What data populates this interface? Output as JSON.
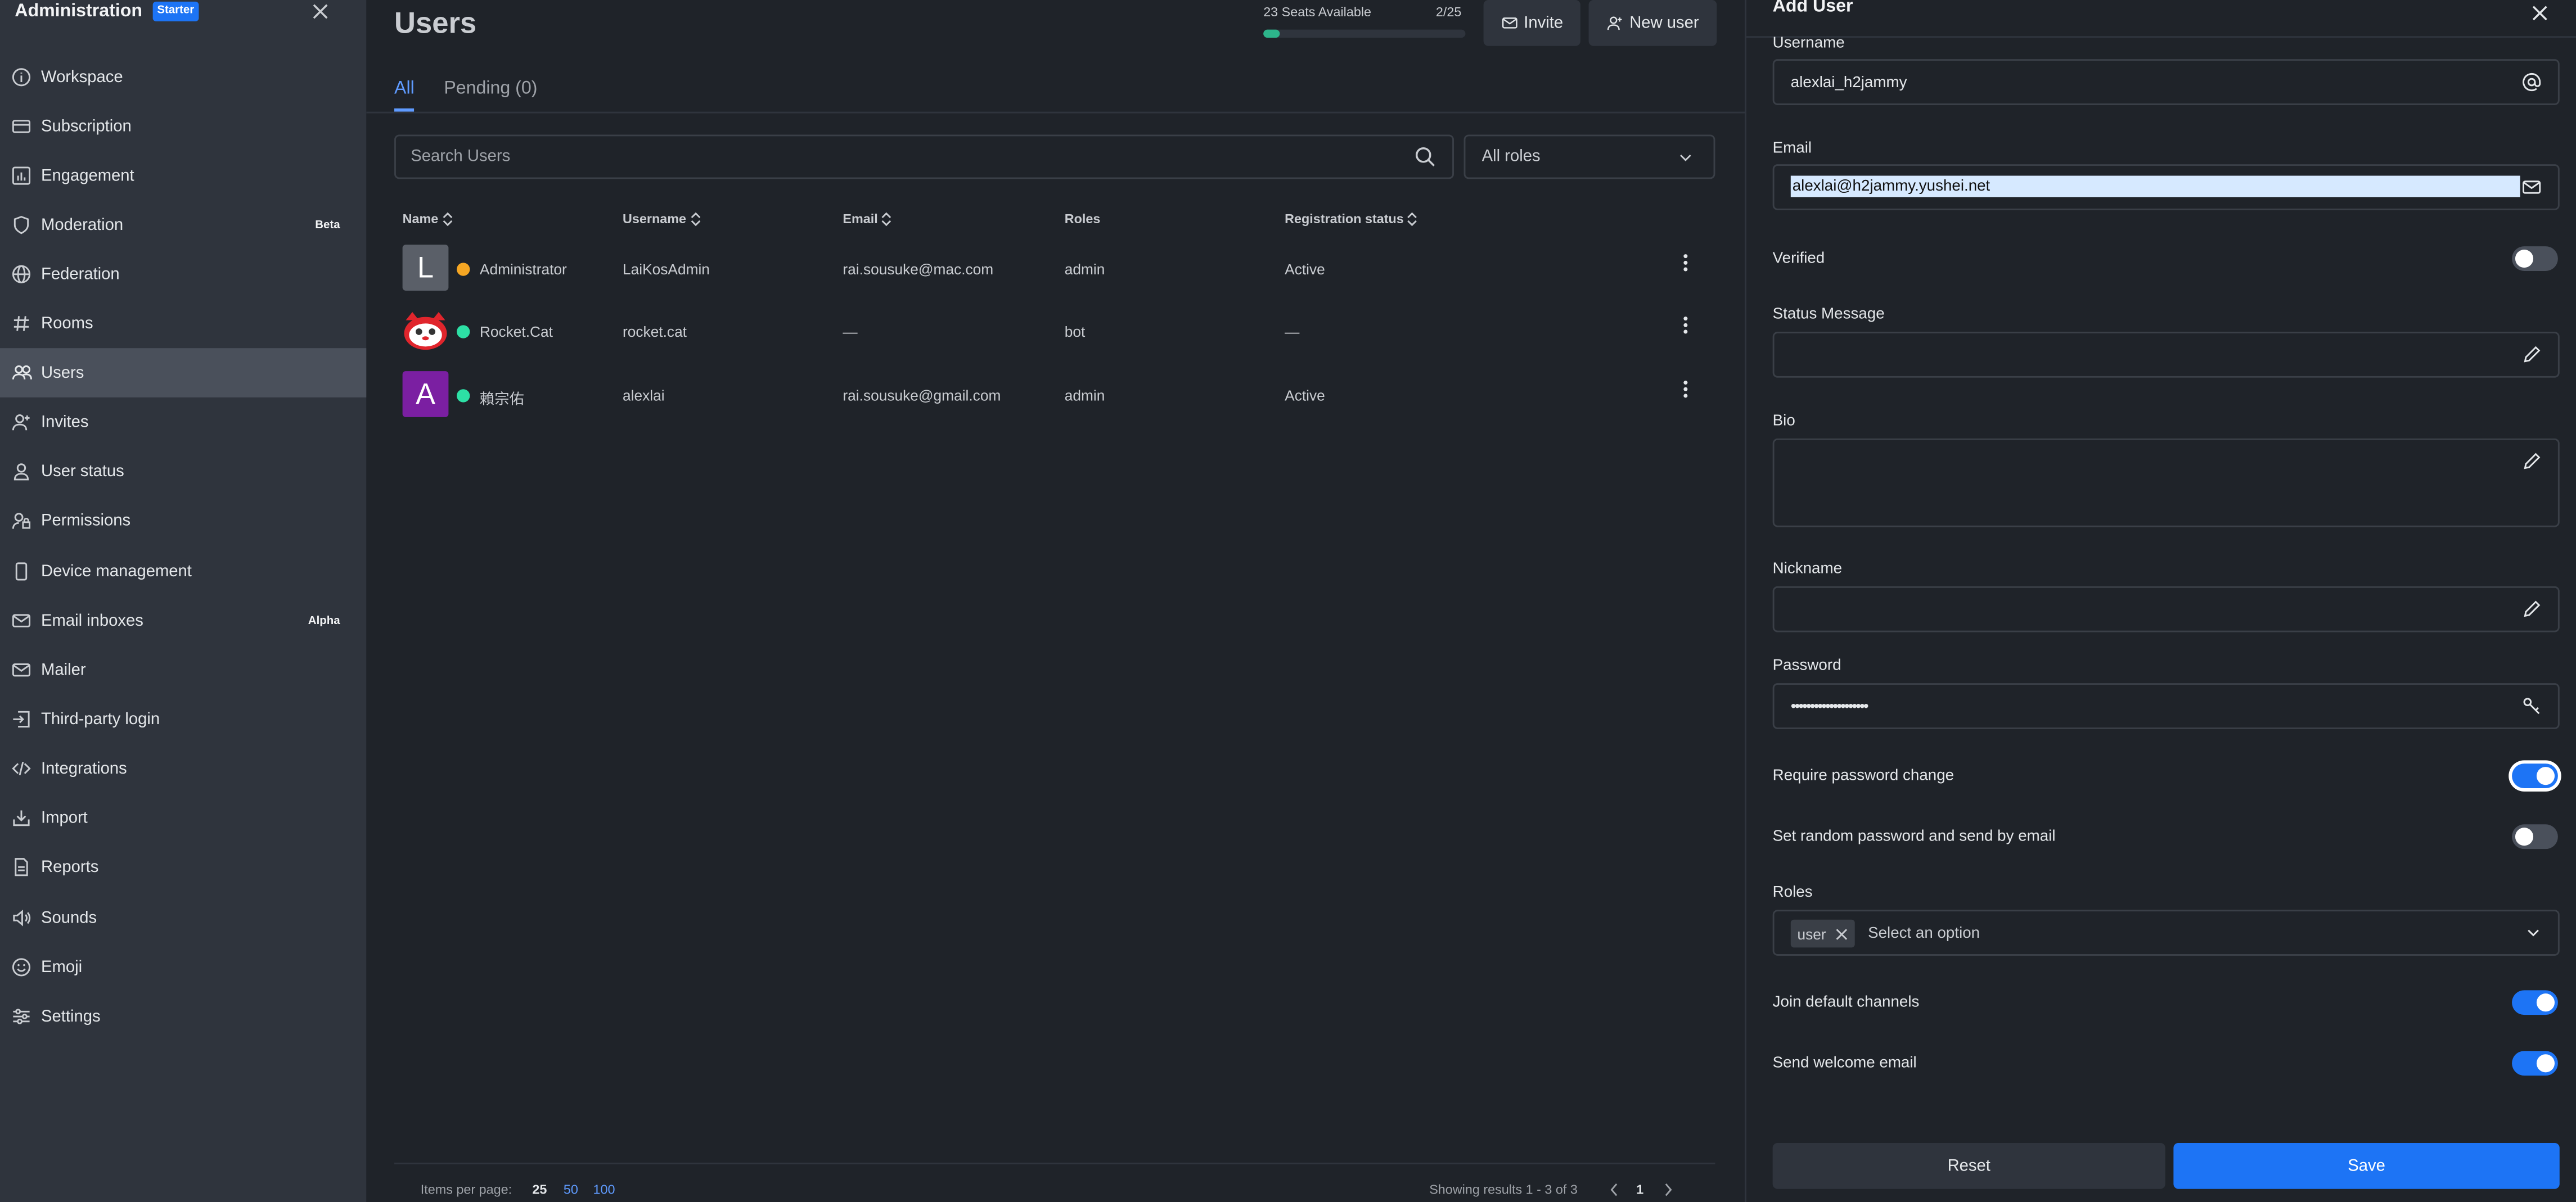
{
  "sidebar": {
    "title": "Administration",
    "badge": "Starter",
    "items": [
      {
        "label": "Workspace",
        "icon": "info-circle-icon"
      },
      {
        "label": "Subscription",
        "icon": "card-icon"
      },
      {
        "label": "Engagement",
        "icon": "chart-icon"
      },
      {
        "label": "Moderation",
        "icon": "shield-icon",
        "tag": "Beta"
      },
      {
        "label": "Federation",
        "icon": "globe-icon"
      },
      {
        "label": "Rooms",
        "icon": "hashtag-icon"
      },
      {
        "label": "Users",
        "icon": "team-icon"
      },
      {
        "label": "Invites",
        "icon": "user-plus-icon"
      },
      {
        "label": "User status",
        "icon": "user-icon"
      },
      {
        "label": "Permissions",
        "icon": "user-lock-icon"
      },
      {
        "label": "Device management",
        "icon": "mobile-icon"
      },
      {
        "label": "Email inboxes",
        "icon": "mail-icon",
        "tag": "Alpha"
      },
      {
        "label": "Mailer",
        "icon": "mail-icon"
      },
      {
        "label": "Third-party login",
        "icon": "login-icon"
      },
      {
        "label": "Integrations",
        "icon": "code-icon"
      },
      {
        "label": "Import",
        "icon": "import-icon"
      },
      {
        "label": "Reports",
        "icon": "document-icon"
      },
      {
        "label": "Sounds",
        "icon": "sound-icon"
      },
      {
        "label": "Emoji",
        "icon": "emoji-icon"
      },
      {
        "label": "Settings",
        "icon": "sliders-icon"
      }
    ]
  },
  "main": {
    "title": "Users",
    "seats": {
      "label": "23 Seats Available",
      "count": "2/25",
      "fraction": 0.08
    },
    "invite_label": "Invite",
    "new_user_label": "New user",
    "tabs": [
      "All",
      "Pending (0)"
    ],
    "search_placeholder": "Search Users",
    "roles_filter": "All roles",
    "columns": [
      "Name",
      "Username",
      "Email",
      "Roles",
      "Registration status"
    ],
    "rows": [
      {
        "avatar": "L",
        "avatar_color": "#5a5f68",
        "status_color": "#f5a623",
        "name": "Administrator",
        "username": "LaiKosAdmin",
        "email": "rai.sousuke@mac.com",
        "roles": "admin",
        "status": "Active"
      },
      {
        "avatar": "",
        "avatar_color": "#ffffff",
        "status_color": "#2de0a5",
        "name": "Rocket.Cat",
        "username": "rocket.cat",
        "email": "—",
        "roles": "bot",
        "status": "—"
      },
      {
        "avatar": "A",
        "avatar_color": "#7b1fa2",
        "status_color": "#2de0a5",
        "name": "賴宗佑",
        "username": "alexlai",
        "email": "rai.sousuke@gmail.com",
        "roles": "admin",
        "status": "Active"
      }
    ],
    "items_per_page_label": "Items per page:",
    "page_sizes": [
      "25",
      "50",
      "100"
    ],
    "results_text": "Showing results 1 - 3 of 3",
    "current_page": "1"
  },
  "panel": {
    "title": "Add User",
    "username_label": "Username",
    "username_value": "alexlai_h2jammy",
    "email_label": "Email",
    "email_value": "alexlai@h2jammy.yushei.net",
    "verified_label": "Verified",
    "status_message_label": "Status Message",
    "bio_label": "Bio",
    "nickname_label": "Nickname",
    "password_label": "Password",
    "password_value": "••••••••••••••••••••",
    "require_password_change_label": "Require password change",
    "random_password_label": "Set random password and send by email",
    "roles_label": "Roles",
    "role_chip": "user",
    "roles_placeholder": "Select an option",
    "join_default_label": "Join default channels",
    "welcome_email_label": "Send welcome email",
    "reset_label": "Reset",
    "save_label": "Save"
  },
  "colors": {
    "accent": "#1d74f5",
    "online": "#2de0a5",
    "away": "#f5a623",
    "sidebar_bg": "#2f343d",
    "main_bg": "#1f2329"
  }
}
